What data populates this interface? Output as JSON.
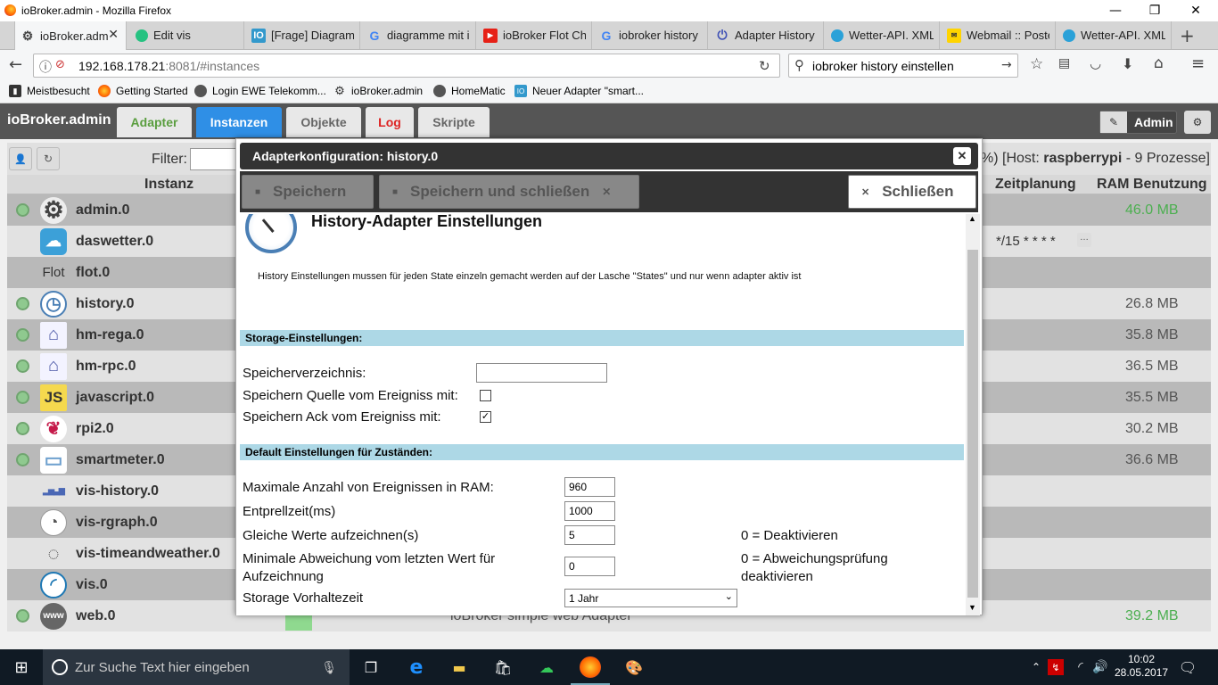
{
  "window": {
    "title": "ioBroker.admin - Mozilla Firefox"
  },
  "browser_tabs": [
    {
      "label": "ioBroker.adm",
      "icon": "gear-icon",
      "active": true
    },
    {
      "label": "Edit vis",
      "icon": "vis-icon"
    },
    {
      "label": "[Frage] Diagram",
      "icon": "iobroker-io-icon"
    },
    {
      "label": "diagramme mit i",
      "icon": "google-icon"
    },
    {
      "label": "ioBroker Flot Cha",
      "icon": "youtube-icon"
    },
    {
      "label": "iobroker history",
      "icon": "google-icon"
    },
    {
      "label": "Adapter History -",
      "icon": "power-icon"
    },
    {
      "label": "Wetter-API. XML",
      "icon": "cloud-icon"
    },
    {
      "label": "Webmail :: Poste",
      "icon": "mail-icon"
    },
    {
      "label": "Wetter-API. XML",
      "icon": "cloud-icon"
    }
  ],
  "nav": {
    "url_host": "192.168.178.21",
    "url_rest": ":8081/#instances",
    "search_value": "iobroker history einstellen"
  },
  "bookmarks": [
    "Meistbesucht",
    "Getting Started",
    "Login EWE Telekomm...",
    "ioBroker.admin",
    "HomeMatic",
    "Neuer Adapter \"smart..."
  ],
  "app": {
    "title": "ioBroker.admin",
    "tabs": [
      "Adapter",
      "Instanzen",
      "Objekte",
      "Log",
      "Skripte"
    ],
    "user": "Admin",
    "filter_label": "Filter:",
    "col_instanz": "Instanz",
    "col_zeitplanung": "Zeitplanung",
    "col_ram": "RAM Benutzung",
    "host_info_prefix": "%) [Host: ",
    "host_name": "raspberrypi",
    "host_info_suffix": " - 9 Prozesse]",
    "daswetter_schedule": "*/15 * * * *",
    "web_desc": "ioBroker simple web Adapter"
  },
  "instances": [
    {
      "name": "admin.0",
      "ram": "46.0 MB",
      "ram_color": "#4caf50",
      "active": true,
      "icon": "gear-icon"
    },
    {
      "name": "daswetter.0",
      "ram": "",
      "active": false,
      "icon": "cloud-icon"
    },
    {
      "name": "flot.0",
      "ram": "",
      "active": false,
      "icon": "flot-icon",
      "icon_text": "Flot"
    },
    {
      "name": "history.0",
      "ram": "26.8 MB",
      "active": true,
      "icon": "clock-icon"
    },
    {
      "name": "hm-rega.0",
      "ram": "35.8 MB",
      "active": true,
      "icon": "homematic-icon"
    },
    {
      "name": "hm-rpc.0",
      "ram": "36.5 MB",
      "active": true,
      "icon": "homematic-icon"
    },
    {
      "name": "javascript.0",
      "ram": "35.5 MB",
      "active": true,
      "icon": "js-icon",
      "icon_text": "JS"
    },
    {
      "name": "rpi2.0",
      "ram": "30.2 MB",
      "active": true,
      "icon": "raspberry-icon"
    },
    {
      "name": "smartmeter.0",
      "ram": "36.6 MB",
      "active": true,
      "icon": "meter-icon"
    },
    {
      "name": "vis-history.0",
      "ram": "",
      "active": false,
      "icon": "bars-icon"
    },
    {
      "name": "vis-rgraph.0",
      "ram": "",
      "active": false,
      "icon": "gauge-icon"
    },
    {
      "name": "vis-timeandweather.0",
      "ram": "",
      "active": false,
      "icon": "weather-icon"
    },
    {
      "name": "vis.0",
      "ram": "",
      "active": false,
      "icon": "vis-icon"
    },
    {
      "name": "web.0",
      "ram": "39.2 MB",
      "ram_color": "#4caf50",
      "active": true,
      "icon": "www-icon",
      "icon_text": "www"
    }
  ],
  "modal": {
    "title": "Adapterkonfiguration: history.0",
    "save_label": "Speichern",
    "save_close_label": "Speichern und schließen",
    "close_label": "Schließen",
    "heading": "History-Adapter Einstellungen",
    "info": "History Einstellungen mussen für jeden State einzeln gemacht werden auf der Lasche \"States\" und nur wenn adapter aktiv ist",
    "section_storage": "Storage-Einstellungen:",
    "label_dir": "Speicherverzeichnis:",
    "value_dir": "",
    "label_source": "Speichern Quelle vom Ereigniss mit:",
    "source_checked": false,
    "label_ack": "Speichern Ack vom Ereigniss mit:",
    "ack_checked": true,
    "check_mark": "✓",
    "section_default": "Default Einstellungen für Zuständen:",
    "label_max": "Maximale Anzahl von Ereignissen in RAM:",
    "value_max": "960",
    "label_debounce": "Entprellzeit(ms)",
    "value_debounce": "1000",
    "label_same": "Gleiche Werte aufzeichnen(s)",
    "value_same": "5",
    "note_same": "0 = Deaktivieren",
    "label_minchange": "Minimale Abweichung vom letzten Wert für Aufzeichnung",
    "value_minchange": "0",
    "note_minchange": "0 = Abweichungsprüfung deaktivieren",
    "label_retention": "Storage Vorhaltezeit",
    "value_retention": "1 Jahr"
  },
  "taskbar": {
    "search_placeholder": "Zur Suche Text hier eingeben",
    "time": "10:02",
    "date": "28.05.2017"
  },
  "colors": {
    "active_tab": "#2f8fe6",
    "adapter_tab": "#5a9e3f",
    "log_tab": "#d22",
    "ram_green": "#4caf50"
  }
}
